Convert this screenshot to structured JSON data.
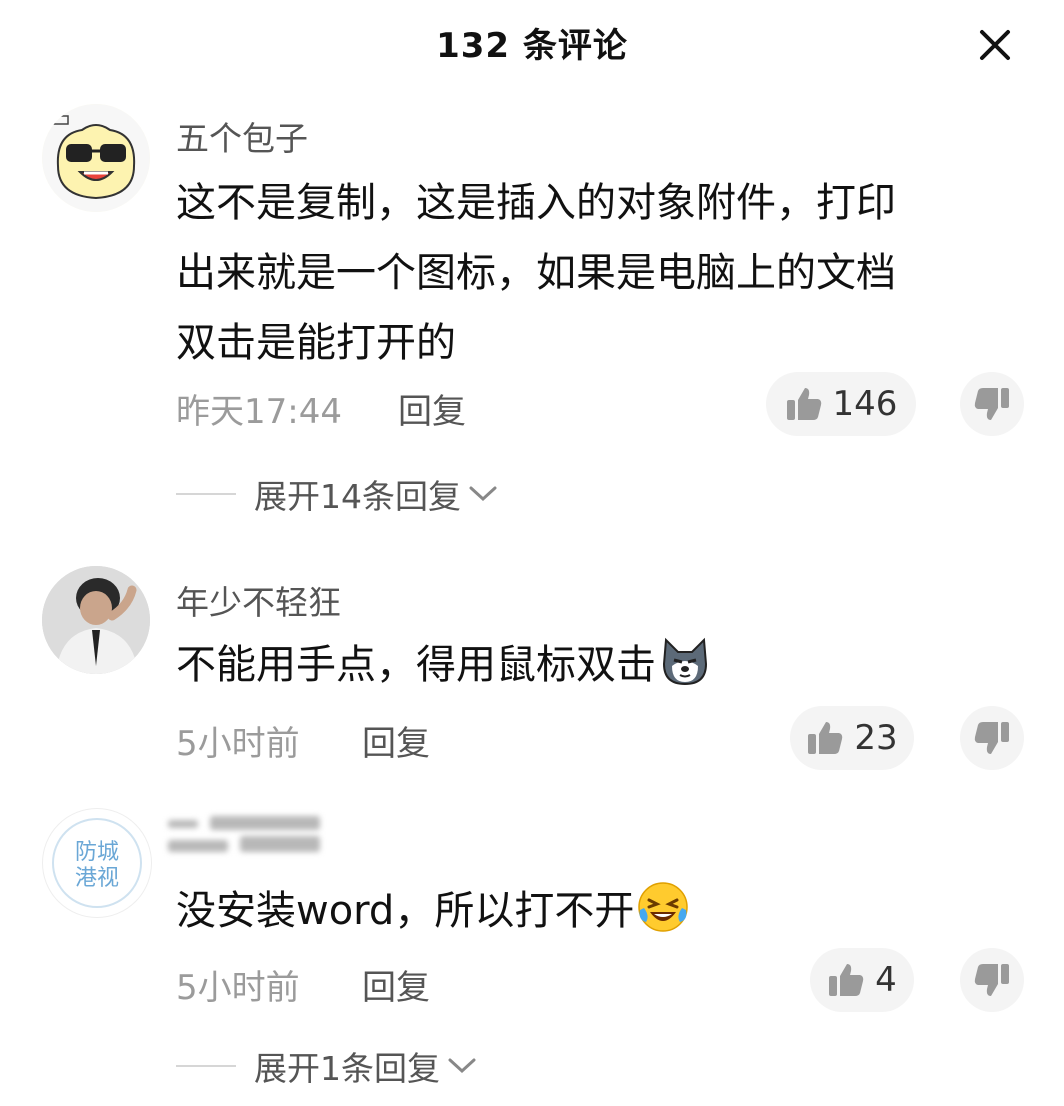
{
  "header": {
    "title": "132 条评论"
  },
  "comments": [
    {
      "username": "五个包子",
      "lines": [
        "这不是复制，这是插入的对象附件，打印",
        "出来就是一个图标，如果是电脑上的文档",
        "双击是能打开的"
      ],
      "time": "昨天17:44",
      "reply_label": "回复",
      "likes": "146",
      "expand_label": "展开14条回复",
      "avatar": "sunglasses-bun-avatar"
    },
    {
      "username": "年少不轻狂",
      "text": "不能用手点，得用鼠标双击",
      "emoji": "husky-emoji",
      "time": "5小时前",
      "reply_label": "回复",
      "likes": "23",
      "avatar": "person-photo-avatar"
    },
    {
      "username_blurred": true,
      "text": "没安装word，所以打不开",
      "emoji": "laughing-tears-emoji",
      "time": "5小时前",
      "reply_label": "回复",
      "likes": "4",
      "expand_label": "展开1条回复",
      "avatar": "防城港视",
      "avatar_lines": [
        "防城",
        "港视"
      ]
    }
  ],
  "icons": {
    "close": "close-icon",
    "like": "thumbs-up-icon",
    "dislike": "thumbs-down-icon",
    "chevron": "chevron-down-icon"
  },
  "colors": {
    "text": "#111111",
    "meta": "#9b9b9b",
    "button_bg": "#f4f4f4",
    "logo_blue": "#6aa7d6"
  }
}
